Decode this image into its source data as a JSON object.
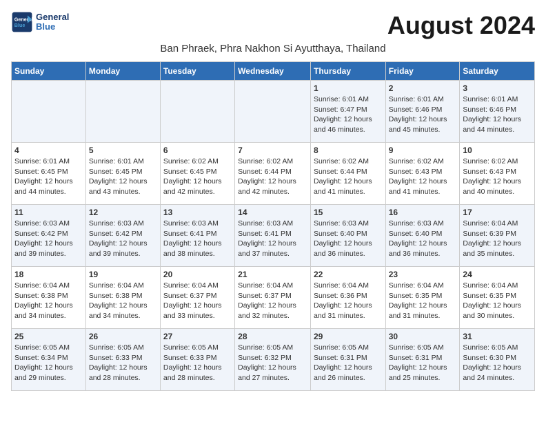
{
  "logo": {
    "line1": "General",
    "line2": "Blue"
  },
  "title": "August 2024",
  "subtitle": "Ban Phraek, Phra Nakhon Si Ayutthaya, Thailand",
  "days_of_week": [
    "Sunday",
    "Monday",
    "Tuesday",
    "Wednesday",
    "Thursday",
    "Friday",
    "Saturday"
  ],
  "weeks": [
    [
      {
        "num": "",
        "info": ""
      },
      {
        "num": "",
        "info": ""
      },
      {
        "num": "",
        "info": ""
      },
      {
        "num": "",
        "info": ""
      },
      {
        "num": "1",
        "info": "Sunrise: 6:01 AM\nSunset: 6:47 PM\nDaylight: 12 hours\nand 46 minutes."
      },
      {
        "num": "2",
        "info": "Sunrise: 6:01 AM\nSunset: 6:46 PM\nDaylight: 12 hours\nand 45 minutes."
      },
      {
        "num": "3",
        "info": "Sunrise: 6:01 AM\nSunset: 6:46 PM\nDaylight: 12 hours\nand 44 minutes."
      }
    ],
    [
      {
        "num": "4",
        "info": "Sunrise: 6:01 AM\nSunset: 6:45 PM\nDaylight: 12 hours\nand 44 minutes."
      },
      {
        "num": "5",
        "info": "Sunrise: 6:01 AM\nSunset: 6:45 PM\nDaylight: 12 hours\nand 43 minutes."
      },
      {
        "num": "6",
        "info": "Sunrise: 6:02 AM\nSunset: 6:45 PM\nDaylight: 12 hours\nand 42 minutes."
      },
      {
        "num": "7",
        "info": "Sunrise: 6:02 AM\nSunset: 6:44 PM\nDaylight: 12 hours\nand 42 minutes."
      },
      {
        "num": "8",
        "info": "Sunrise: 6:02 AM\nSunset: 6:44 PM\nDaylight: 12 hours\nand 41 minutes."
      },
      {
        "num": "9",
        "info": "Sunrise: 6:02 AM\nSunset: 6:43 PM\nDaylight: 12 hours\nand 41 minutes."
      },
      {
        "num": "10",
        "info": "Sunrise: 6:02 AM\nSunset: 6:43 PM\nDaylight: 12 hours\nand 40 minutes."
      }
    ],
    [
      {
        "num": "11",
        "info": "Sunrise: 6:03 AM\nSunset: 6:42 PM\nDaylight: 12 hours\nand 39 minutes."
      },
      {
        "num": "12",
        "info": "Sunrise: 6:03 AM\nSunset: 6:42 PM\nDaylight: 12 hours\nand 39 minutes."
      },
      {
        "num": "13",
        "info": "Sunrise: 6:03 AM\nSunset: 6:41 PM\nDaylight: 12 hours\nand 38 minutes."
      },
      {
        "num": "14",
        "info": "Sunrise: 6:03 AM\nSunset: 6:41 PM\nDaylight: 12 hours\nand 37 minutes."
      },
      {
        "num": "15",
        "info": "Sunrise: 6:03 AM\nSunset: 6:40 PM\nDaylight: 12 hours\nand 36 minutes."
      },
      {
        "num": "16",
        "info": "Sunrise: 6:03 AM\nSunset: 6:40 PM\nDaylight: 12 hours\nand 36 minutes."
      },
      {
        "num": "17",
        "info": "Sunrise: 6:04 AM\nSunset: 6:39 PM\nDaylight: 12 hours\nand 35 minutes."
      }
    ],
    [
      {
        "num": "18",
        "info": "Sunrise: 6:04 AM\nSunset: 6:38 PM\nDaylight: 12 hours\nand 34 minutes."
      },
      {
        "num": "19",
        "info": "Sunrise: 6:04 AM\nSunset: 6:38 PM\nDaylight: 12 hours\nand 34 minutes."
      },
      {
        "num": "20",
        "info": "Sunrise: 6:04 AM\nSunset: 6:37 PM\nDaylight: 12 hours\nand 33 minutes."
      },
      {
        "num": "21",
        "info": "Sunrise: 6:04 AM\nSunset: 6:37 PM\nDaylight: 12 hours\nand 32 minutes."
      },
      {
        "num": "22",
        "info": "Sunrise: 6:04 AM\nSunset: 6:36 PM\nDaylight: 12 hours\nand 31 minutes."
      },
      {
        "num": "23",
        "info": "Sunrise: 6:04 AM\nSunset: 6:35 PM\nDaylight: 12 hours\nand 31 minutes."
      },
      {
        "num": "24",
        "info": "Sunrise: 6:04 AM\nSunset: 6:35 PM\nDaylight: 12 hours\nand 30 minutes."
      }
    ],
    [
      {
        "num": "25",
        "info": "Sunrise: 6:05 AM\nSunset: 6:34 PM\nDaylight: 12 hours\nand 29 minutes."
      },
      {
        "num": "26",
        "info": "Sunrise: 6:05 AM\nSunset: 6:33 PM\nDaylight: 12 hours\nand 28 minutes."
      },
      {
        "num": "27",
        "info": "Sunrise: 6:05 AM\nSunset: 6:33 PM\nDaylight: 12 hours\nand 28 minutes."
      },
      {
        "num": "28",
        "info": "Sunrise: 6:05 AM\nSunset: 6:32 PM\nDaylight: 12 hours\nand 27 minutes."
      },
      {
        "num": "29",
        "info": "Sunrise: 6:05 AM\nSunset: 6:31 PM\nDaylight: 12 hours\nand 26 minutes."
      },
      {
        "num": "30",
        "info": "Sunrise: 6:05 AM\nSunset: 6:31 PM\nDaylight: 12 hours\nand 25 minutes."
      },
      {
        "num": "31",
        "info": "Sunrise: 6:05 AM\nSunset: 6:30 PM\nDaylight: 12 hours\nand 24 minutes."
      }
    ]
  ]
}
